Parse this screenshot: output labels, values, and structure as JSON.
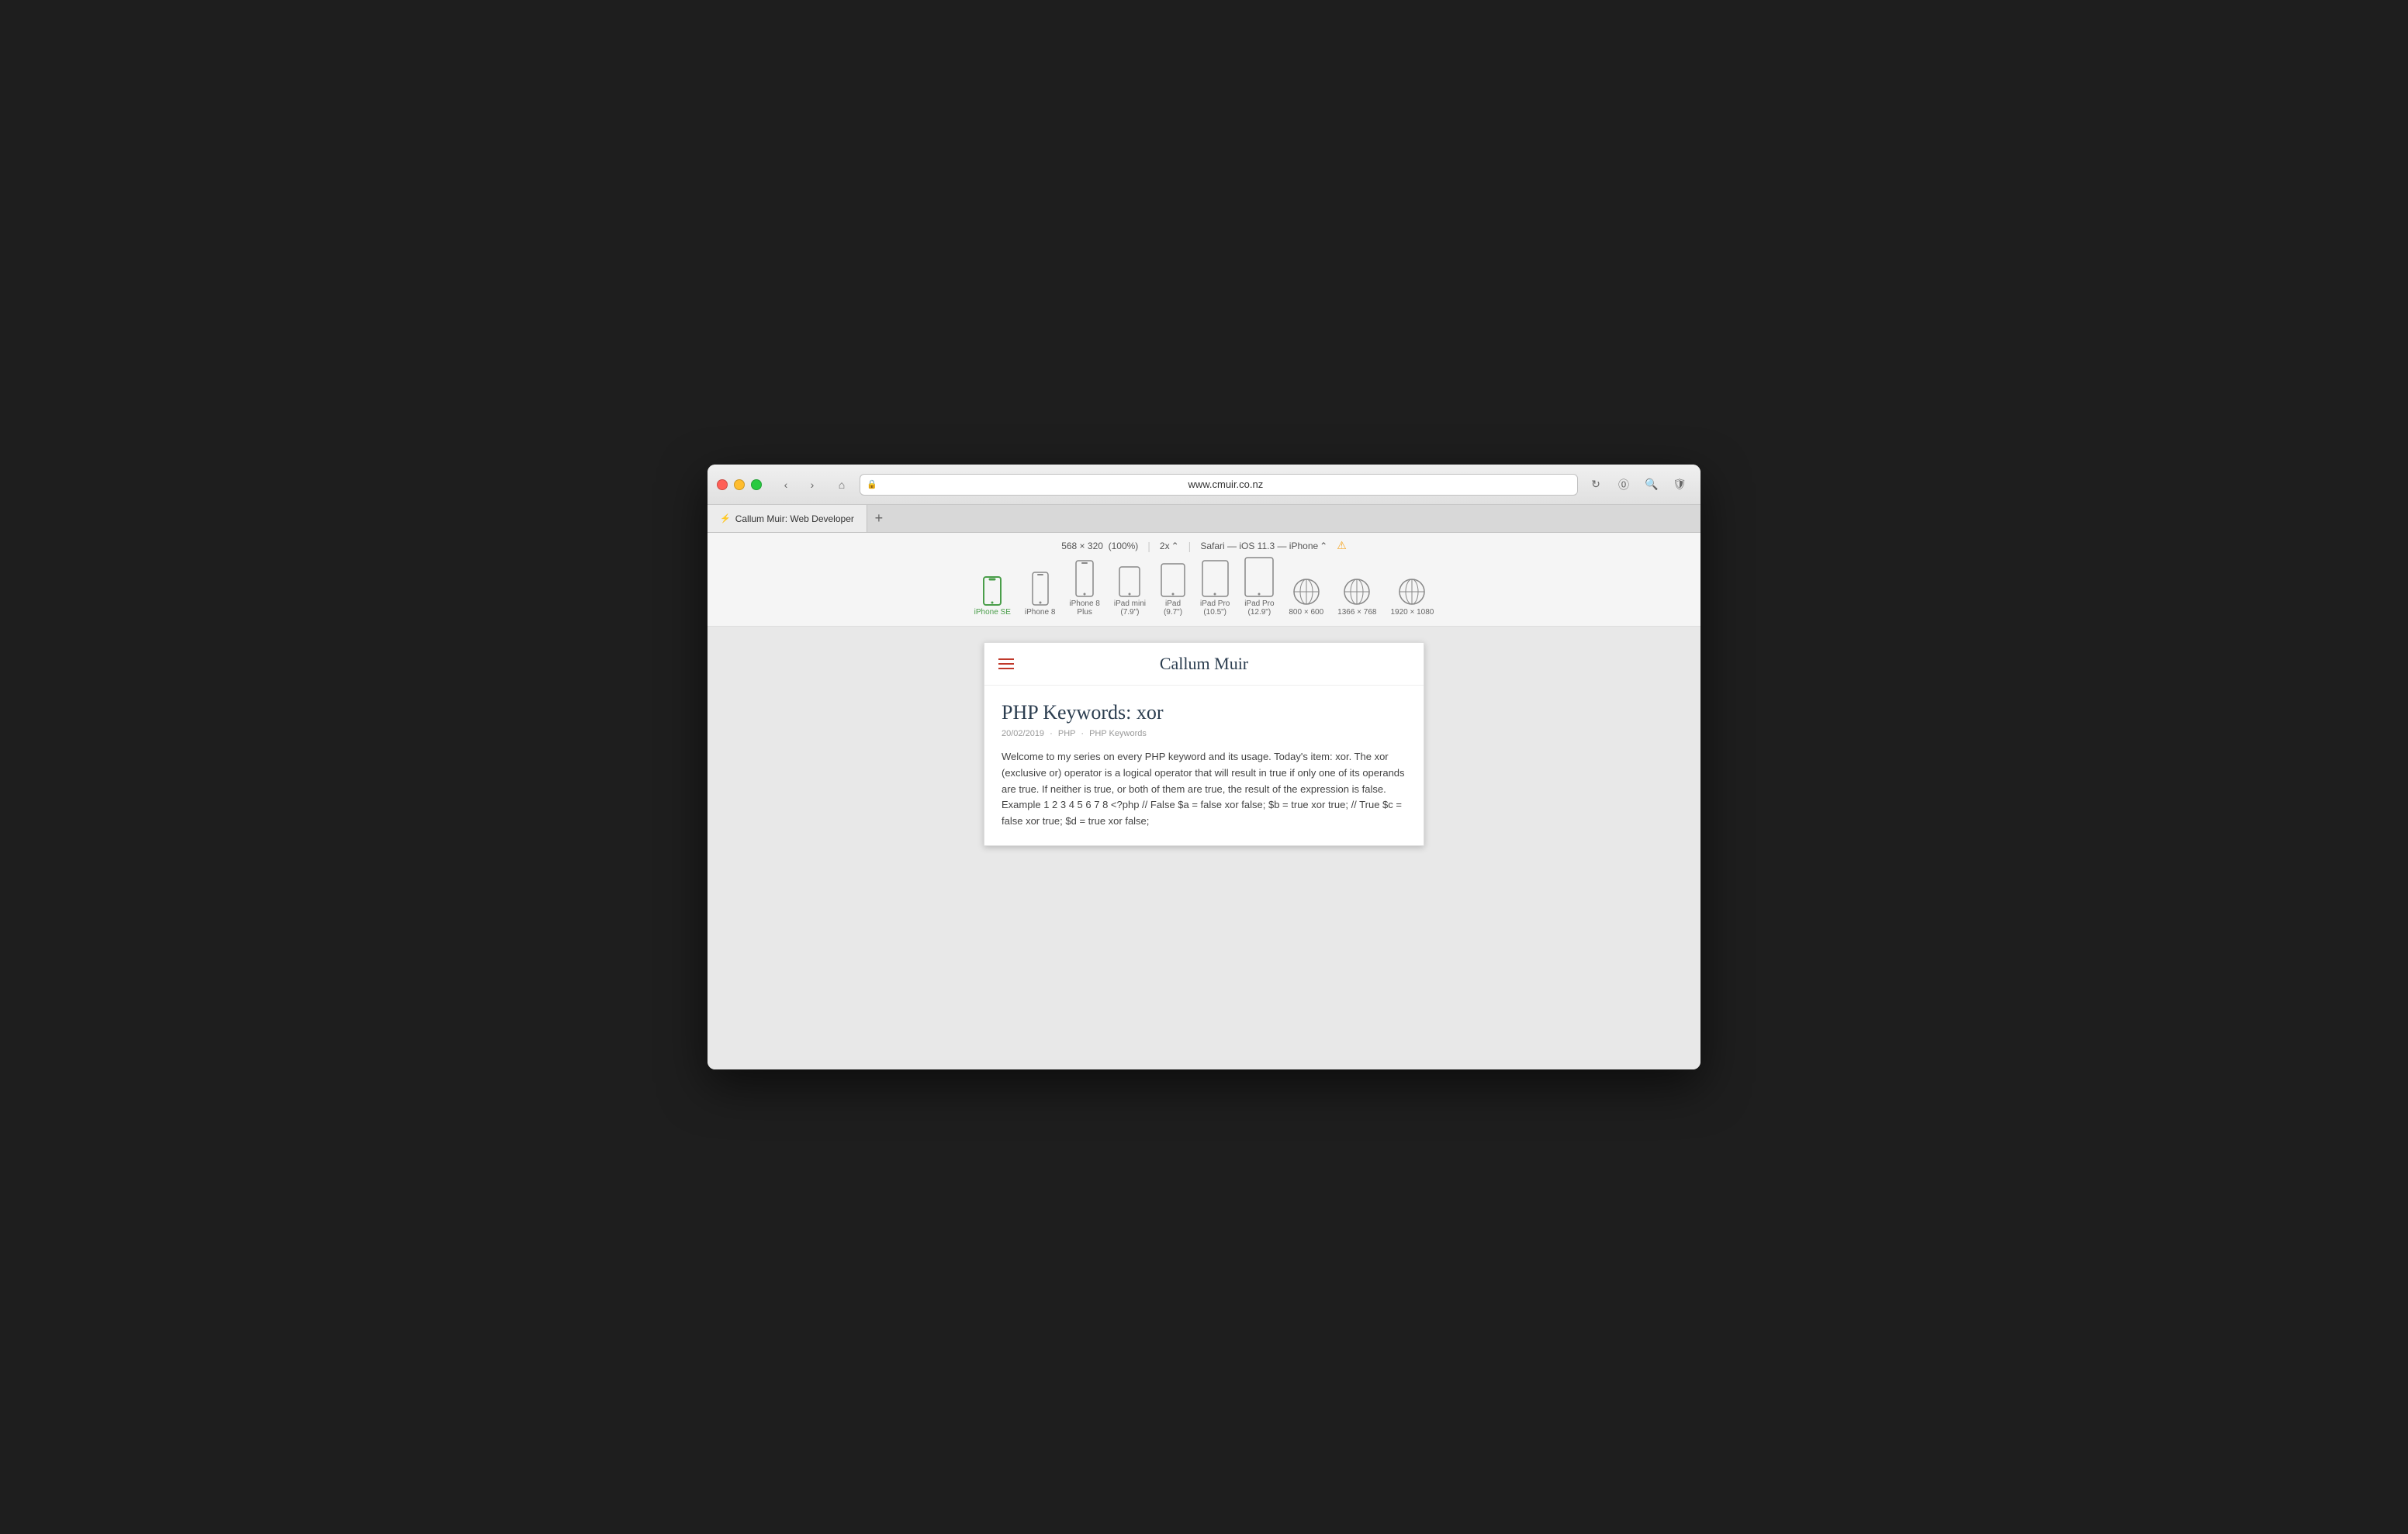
{
  "browser": {
    "url": "www.cmuir.co.nz",
    "tab_label": "Callum Muir: Web Developer",
    "tab_favicon": "⚡",
    "add_tab_label": "+"
  },
  "responsive_bar": {
    "dimensions": "568 × 320",
    "zoom": "(100%)",
    "pixel_ratio": "2x",
    "user_agent": "Safari — iOS 11.3 — iPhone",
    "warning": "⚠"
  },
  "devices": [
    {
      "id": "iphone-se",
      "label": "iPhone SE",
      "active": true,
      "shape": "phone-tall-sm"
    },
    {
      "id": "iphone-8",
      "label": "iPhone 8",
      "active": false,
      "shape": "phone-tall-md"
    },
    {
      "id": "iphone-8-plus",
      "label": "iPhone 8\nPlus",
      "active": false,
      "shape": "phone-tall-lg"
    },
    {
      "id": "ipad-mini",
      "label": "iPad mini\n(7.9\")",
      "active": false,
      "shape": "tablet-sm"
    },
    {
      "id": "ipad",
      "label": "iPad\n(9.7\")",
      "active": false,
      "shape": "tablet-md"
    },
    {
      "id": "ipad-pro-10",
      "label": "iPad Pro\n(10.5\")",
      "active": false,
      "shape": "tablet-lg"
    },
    {
      "id": "ipad-pro-12",
      "label": "iPad Pro\n(12.9\")",
      "active": false,
      "shape": "tablet-xl"
    },
    {
      "id": "800x600",
      "label": "800 × 600",
      "active": false,
      "shape": "compass"
    },
    {
      "id": "1366x768",
      "label": "1366 × 768",
      "active": false,
      "shape": "compass"
    },
    {
      "id": "1920x1080",
      "label": "1920 × 1080",
      "active": false,
      "shape": "compass"
    }
  ],
  "site": {
    "title": "Callum Muir",
    "article": {
      "title": "PHP Keywords: xor",
      "meta_date": "20/02/2019",
      "meta_cat1": "PHP",
      "meta_cat2": "PHP Keywords",
      "body": "Welcome to my series on every PHP keyword and its usage. Today's item: xor. The xor (exclusive or) operator is a logical operator that will result in true if only one of its operands are true. If neither is true, or both of them are true, the result of the expression is false. Example 1 2 3 4 5 6 7 8 <?php // False $a = false xor false; $b = true xor true; // True $c = false xor true; $d = true xor false;"
    }
  }
}
